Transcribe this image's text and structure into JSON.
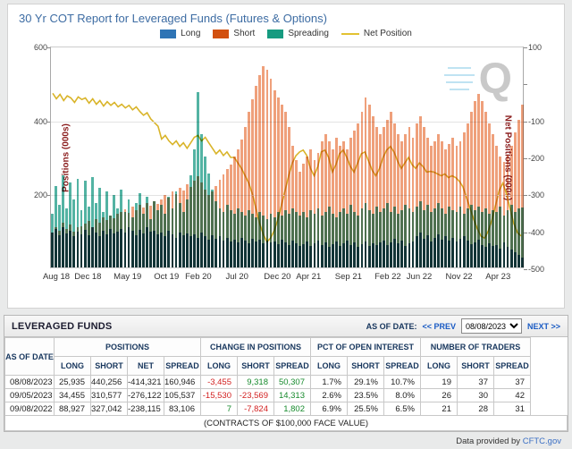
{
  "chart": {
    "title": "30 Yr COT Report for Leveraged Funds (Futures & Options)",
    "watermark": "Q",
    "legend": [
      {
        "label": "Long",
        "color": "#2e74b5",
        "type": "box"
      },
      {
        "label": "Short",
        "color": "#d2500f",
        "type": "box"
      },
      {
        "label": "Spreading",
        "color": "#169b80",
        "type": "box"
      },
      {
        "label": "Net Position",
        "color": "#e2c232",
        "type": "line"
      }
    ]
  },
  "chart_data": {
    "type": "bar",
    "title": "30 Yr COT Report for Leveraged Funds (Futures & Options)",
    "x_start": "Aug 2018",
    "x_end": "Aug 2023",
    "x_samples": "biweekly",
    "left_axis": {
      "label": "Positions (000s)",
      "min": 0,
      "max": 600,
      "ticks": [
        600,
        400,
        200
      ]
    },
    "right_axis": {
      "label": "Net Positions (000s)",
      "min": -500,
      "max": 100,
      "ticks": [
        {
          "v": 100,
          "label": "100"
        },
        {
          "v": 0,
          "label": ""
        },
        {
          "v": -100,
          "label": "-100"
        },
        {
          "v": -200,
          "label": "-200"
        },
        {
          "v": -300,
          "label": "-300"
        },
        {
          "v": -400,
          "label": "-400"
        },
        {
          "v": -500,
          "label": "-500"
        }
      ]
    },
    "gridlines_left_values": [
      400,
      200
    ],
    "x_ticks": [
      {
        "label": "Aug 18",
        "frac": 0.0
      },
      {
        "label": "Dec 18",
        "frac": 0.0667
      },
      {
        "label": "May 19",
        "frac": 0.15
      },
      {
        "label": "Oct 19",
        "frac": 0.2333
      },
      {
        "label": "Feb 20",
        "frac": 0.3
      },
      {
        "label": "Jul 20",
        "frac": 0.3833
      },
      {
        "label": "Dec 20",
        "frac": 0.4667
      },
      {
        "label": "Apr 21",
        "frac": 0.5333
      },
      {
        "label": "Sep 21",
        "frac": 0.6167
      },
      {
        "label": "Feb 22",
        "frac": 0.7
      },
      {
        "label": "Jun 22",
        "frac": 0.7667
      },
      {
        "label": "Nov 22",
        "frac": 0.85
      },
      {
        "label": "Apr 23",
        "frac": 0.9333
      }
    ],
    "series": [
      {
        "name": "Short",
        "render": "bar",
        "axis": "left",
        "color": "#efa07b",
        "values": [
          95,
          110,
          100,
          120,
          105,
          115,
          98,
          108,
          112,
          118,
          125,
          110,
          130,
          122,
          135,
          128,
          140,
          132,
          145,
          150,
          158,
          148,
          165,
          155,
          170,
          162,
          175,
          168,
          180,
          172,
          185,
          195,
          188,
          205,
          198,
          215,
          208,
          225,
          218,
          235,
          248,
          230,
          210,
          195,
          205,
          220,
          238,
          252,
          265,
          278,
          300,
          320,
          345,
          380,
          420,
          455,
          490,
          520,
          545,
          535,
          510,
          480,
          460,
          440,
          420,
          380,
          330,
          290,
          260,
          280,
          300,
          320,
          290,
          310,
          340,
          360,
          340,
          320,
          350,
          330,
          340,
          320,
          350,
          370,
          390,
          420,
          460,
          440,
          410,
          380,
          360,
          380,
          400,
          420,
          390,
          360,
          340,
          360,
          380,
          350,
          390,
          410,
          380,
          350,
          330,
          340,
          360,
          340,
          320,
          335,
          350,
          330,
          340,
          365,
          390,
          420,
          450,
          470,
          450,
          420,
          390,
          360,
          330,
          300,
          285,
          305,
          330,
          365,
          400,
          440
        ]
      },
      {
        "name": "Spreading",
        "render": "bar",
        "axis": "left",
        "color": "#53b3a3",
        "values": [
          145,
          220,
          170,
          250,
          160,
          230,
          185,
          240,
          155,
          235,
          165,
          245,
          175,
          215,
          150,
          205,
          140,
          195,
          160,
          210,
          150,
          185,
          135,
          175,
          200,
          145,
          190,
          130,
          180,
          155,
          170,
          145,
          190,
          160,
          205,
          175,
          150,
          185,
          250,
          320,
          475,
          360,
          300,
          255,
          210,
          180,
          160,
          150,
          170,
          155,
          145,
          160,
          150,
          140,
          155,
          145,
          135,
          150,
          140,
          130,
          145,
          135,
          150,
          140,
          155,
          145,
          160,
          150,
          140,
          150,
          135,
          155,
          145,
          160,
          140,
          150,
          165,
          145,
          135,
          150,
          160,
          145,
          170,
          150,
          140,
          160,
          175,
          155,
          145,
          165,
          150,
          160,
          175,
          150,
          165,
          145,
          155,
          170,
          160,
          150,
          165,
          180,
          155,
          170,
          150,
          160,
          175,
          160,
          145,
          165,
          155,
          150,
          165,
          145,
          160,
          170,
          155,
          165,
          150,
          160,
          145,
          155,
          150,
          165,
          140,
          155,
          170,
          150,
          160,
          161
        ]
      },
      {
        "name": "Long",
        "render": "bar",
        "axis": "left",
        "color": "#3a76ad",
        "values": [
          95,
          105,
          88,
          110,
          92,
          100,
          85,
          98,
          90,
          102,
          88,
          108,
          95,
          85,
          100,
          90,
          105,
          92,
          98,
          105,
          95,
          110,
          100,
          88,
          102,
          92,
          108,
          96,
          100,
          90,
          95,
          85,
          100,
          90,
          80,
          95,
          88,
          92,
          85,
          90,
          80,
          95,
          85,
          75,
          88,
          78,
          85,
          72,
          80,
          70,
          75,
          68,
          80,
          72,
          65,
          78,
          70,
          75,
          65,
          72,
          68,
          70,
          62,
          75,
          68,
          60,
          72,
          65,
          58,
          62,
          70,
          58,
          65,
          72,
          60,
          68,
          55,
          62,
          70,
          58,
          65,
          72,
          60,
          68,
          55,
          62,
          70,
          58,
          65,
          60,
          68,
          72,
          60,
          68,
          78,
          65,
          72,
          58,
          66,
          70,
          85,
          95,
          78,
          88,
          70,
          80,
          90,
          75,
          85,
          72,
          80,
          70,
          78,
          85,
          72,
          62,
          68,
          75,
          60,
          55,
          65,
          58,
          60,
          52,
          68,
          55,
          48,
          42,
          35,
          26
        ]
      },
      {
        "name": "Net Position",
        "render": "line",
        "axis": "right",
        "color": "#d9b429",
        "values": [
          -25,
          -40,
          -28,
          -45,
          -32,
          -38,
          -50,
          -35,
          -42,
          -38,
          -52,
          -40,
          -55,
          -45,
          -60,
          -48,
          -58,
          -50,
          -62,
          -55,
          -65,
          -58,
          -70,
          -62,
          -75,
          -85,
          -78,
          -95,
          -105,
          -115,
          -150,
          -140,
          -155,
          -165,
          -155,
          -170,
          -160,
          -175,
          -160,
          -145,
          -140,
          -155,
          -145,
          -160,
          -175,
          -190,
          -180,
          -195,
          -185,
          -200,
          -200,
          -215,
          -230,
          -250,
          -270,
          -300,
          -340,
          -380,
          -410,
          -430,
          -420,
          -400,
          -370,
          -330,
          -290,
          -250,
          -215,
          -195,
          -185,
          -180,
          -195,
          -230,
          -250,
          -225,
          -185,
          -180,
          -200,
          -240,
          -220,
          -190,
          -180,
          -200,
          -225,
          -240,
          -215,
          -190,
          -185,
          -210,
          -235,
          -250,
          -230,
          -200,
          -180,
          -170,
          -185,
          -210,
          -230,
          -215,
          -200,
          -220,
          -230,
          -215,
          -225,
          -240,
          -238,
          -240,
          -245,
          -250,
          -245,
          -255,
          -250,
          -255,
          -265,
          -280,
          -310,
          -340,
          -370,
          -395,
          -415,
          -420,
          -400,
          -370,
          -330,
          -290,
          -270,
          -300,
          -340,
          -380,
          -405,
          -414
        ]
      }
    ]
  },
  "table": {
    "section_title": "LEVERAGED FUNDS",
    "as_of_label": "AS OF DATE:",
    "prev_label": "<< PREV",
    "next_label": "NEXT >>",
    "date_select_value": "08/08/2023",
    "row_header": "AS OF DATE",
    "col_groups": [
      {
        "label": "POSITIONS",
        "sub": [
          "LONG",
          "SHORT",
          "NET",
          "SPREAD"
        ]
      },
      {
        "label": "CHANGE IN POSITIONS",
        "sub": [
          "LONG",
          "SHORT",
          "SPREAD"
        ]
      },
      {
        "label": "PCT OF OPEN INTEREST",
        "sub": [
          "LONG",
          "SHORT",
          "SPREAD"
        ]
      },
      {
        "label": "NUMBER OF TRADERS",
        "sub": [
          "LONG",
          "SHORT",
          "SPREAD"
        ]
      }
    ],
    "rows": [
      {
        "date": "08/08/2023",
        "positions": [
          "25,935",
          "440,256",
          "-414,321",
          "160,946"
        ],
        "change": [
          {
            "v": "-3,455",
            "sign": "neg"
          },
          {
            "v": "9,318",
            "sign": "pos"
          },
          {
            "v": "50,307",
            "sign": "pos"
          }
        ],
        "pct": [
          "1.7%",
          "29.1%",
          "10.7%"
        ],
        "traders": [
          "19",
          "37",
          "37"
        ]
      },
      {
        "date": "09/05/2023",
        "positions": [
          "34,455",
          "310,577",
          "-276,122",
          "105,537"
        ],
        "change": [
          {
            "v": "-15,530",
            "sign": "neg"
          },
          {
            "v": "-23,569",
            "sign": "neg"
          },
          {
            "v": "14,313",
            "sign": "pos"
          }
        ],
        "pct": [
          "2.6%",
          "23.5%",
          "8.0%"
        ],
        "traders": [
          "26",
          "30",
          "42"
        ]
      },
      {
        "date": "09/08/2022",
        "positions": [
          "88,927",
          "327,042",
          "-238,115",
          "83,106"
        ],
        "change": [
          {
            "v": "7",
            "sign": "pos"
          },
          {
            "v": "-7,824",
            "sign": "neg"
          },
          {
            "v": "1,802",
            "sign": "pos"
          }
        ],
        "pct": [
          "6.9%",
          "25.5%",
          "6.5%"
        ],
        "traders": [
          "21",
          "28",
          "31"
        ]
      }
    ],
    "caption": "(CONTRACTS OF $100,000 FACE VALUE)"
  },
  "footer": {
    "text": "Data provided by ",
    "link_label": "CFTC.gov"
  }
}
